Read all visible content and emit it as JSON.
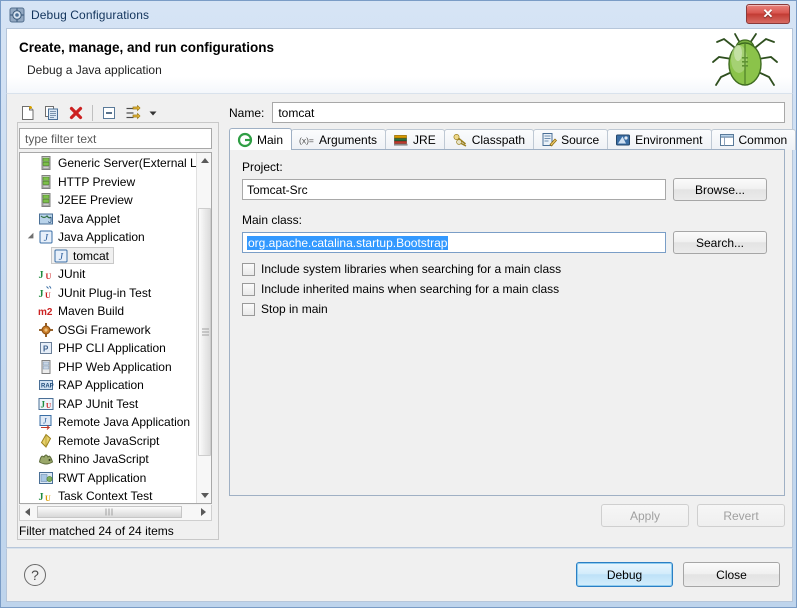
{
  "window": {
    "title": "Debug Configurations",
    "title_icon": "debug-config-icon",
    "close_label": "✕"
  },
  "header": {
    "title": "Create, manage, and run configurations",
    "subtitle": "Debug a Java application",
    "image": "green-bug-illustration"
  },
  "left": {
    "toolbar": [
      {
        "name": "new-launch-configuration",
        "icon": "new-document-icon"
      },
      {
        "name": "duplicate-launch-configuration",
        "icon": "copy-icon"
      },
      {
        "name": "delete-launch-configuration",
        "icon": "delete-red-x-icon"
      },
      {
        "name": "collapse-all",
        "icon": "collapse-all-icon"
      },
      {
        "name": "filter-launch-configurations",
        "icon": "filter-icon"
      },
      {
        "name": "view-menu",
        "icon": "chevron-down-icon"
      }
    ],
    "filter": {
      "placeholder": "type filter text",
      "value": ""
    },
    "tree": [
      {
        "label": "Generic Server(External La",
        "icon": "server-icon",
        "level": 0,
        "twisty": false,
        "selected": false
      },
      {
        "label": "HTTP Preview",
        "icon": "server-icon",
        "level": 0,
        "twisty": false,
        "selected": false
      },
      {
        "label": "J2EE Preview",
        "icon": "server-icon",
        "level": 0,
        "twisty": false,
        "selected": false
      },
      {
        "label": "Java Applet",
        "icon": "java-applet-icon",
        "level": 0,
        "twisty": false,
        "selected": false
      },
      {
        "label": "Java Application",
        "icon": "java-app-icon",
        "level": 0,
        "twisty": true,
        "selected": false
      },
      {
        "label": "tomcat",
        "icon": "java-app-icon",
        "level": 1,
        "twisty": false,
        "selected": true
      },
      {
        "label": "JUnit",
        "icon": "junit-icon",
        "level": 0,
        "twisty": false,
        "selected": false
      },
      {
        "label": "JUnit Plug-in Test",
        "icon": "junit-plugin-icon",
        "level": 0,
        "twisty": false,
        "selected": false
      },
      {
        "label": "Maven Build",
        "icon": "maven-icon",
        "level": 0,
        "twisty": false,
        "selected": false
      },
      {
        "label": "OSGi Framework",
        "icon": "osgi-icon",
        "level": 0,
        "twisty": false,
        "selected": false
      },
      {
        "label": "PHP CLI Application",
        "icon": "php-cli-icon",
        "level": 0,
        "twisty": false,
        "selected": false
      },
      {
        "label": "PHP Web Application",
        "icon": "php-web-icon",
        "level": 0,
        "twisty": false,
        "selected": false
      },
      {
        "label": "RAP Application",
        "icon": "rap-icon",
        "level": 0,
        "twisty": false,
        "selected": false
      },
      {
        "label": "RAP JUnit Test",
        "icon": "rap-junit-icon",
        "level": 0,
        "twisty": false,
        "selected": false
      },
      {
        "label": "Remote Java Application",
        "icon": "remote-java-icon",
        "level": 0,
        "twisty": false,
        "selected": false
      },
      {
        "label": "Remote JavaScript",
        "icon": "remote-js-icon",
        "level": 0,
        "twisty": false,
        "selected": false
      },
      {
        "label": "Rhino JavaScript",
        "icon": "rhino-icon",
        "level": 0,
        "twisty": false,
        "selected": false
      },
      {
        "label": "RWT Application",
        "icon": "rwt-icon",
        "level": 0,
        "twisty": false,
        "selected": false
      },
      {
        "label": "Task Context Test",
        "icon": "task-context-icon",
        "level": 0,
        "twisty": false,
        "selected": false
      }
    ],
    "status": "Filter matched 24 of 24 items"
  },
  "right": {
    "name_label": "Name:",
    "name_value": "tomcat",
    "tabs": [
      {
        "label": "Main",
        "icon": "main-green-circle-icon",
        "active": true
      },
      {
        "label": "Arguments",
        "icon": "arguments-icon",
        "active": false
      },
      {
        "label": "JRE",
        "icon": "jre-books-icon",
        "active": false
      },
      {
        "label": "Classpath",
        "icon": "classpath-icon",
        "active": false
      },
      {
        "label": "Source",
        "icon": "source-icon",
        "active": false
      },
      {
        "label": "Environment",
        "icon": "environment-icon",
        "active": false
      },
      {
        "label": "Common",
        "icon": "common-icon",
        "active": false
      }
    ],
    "project_label": "Project:",
    "project_value": "Tomcat-Src",
    "browse_label": "Browse...",
    "main_class_label": "Main class:",
    "main_class_value": "org.apache.catalina.startup.Bootstrap",
    "main_class_selected": true,
    "search_label": "Search...",
    "checkboxes": [
      {
        "label": "Include system libraries when searching for a main class",
        "checked": false
      },
      {
        "label": "Include inherited mains when searching for a main class",
        "checked": false
      },
      {
        "label": "Stop in main",
        "checked": false
      }
    ],
    "apply_label": "Apply",
    "revert_label": "Revert",
    "apply_enabled": false,
    "revert_enabled": false
  },
  "footer": {
    "help_label": "?",
    "debug_label": "Debug",
    "close_label": "Close"
  },
  "colors": {
    "accent_blue": "#3399ff",
    "title_blue": "#12345c",
    "close_red": "#c23b33",
    "default_button_border": "#2b7fc4"
  }
}
